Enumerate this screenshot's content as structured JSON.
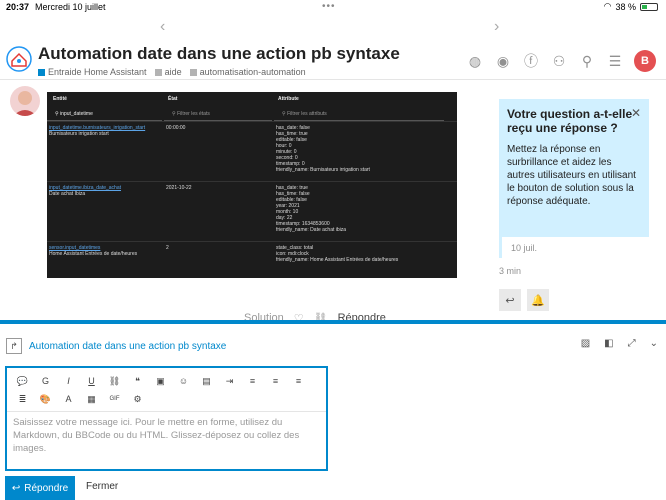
{
  "status_bar": {
    "time": "20:37",
    "date": "Mercredi 10 juillet",
    "battery": "38 %",
    "battery_level": 0.38
  },
  "topic": {
    "title": "Automation date dans une action pb syntaxe",
    "breadcrumbs": [
      {
        "label": "Entraide Home Assistant",
        "color": "#0088cc"
      },
      {
        "label": "aide",
        "color": "#b3b3b3"
      },
      {
        "label": "automatisation-automation",
        "color": "#b3b3b3"
      }
    ]
  },
  "header": {
    "user_initial": "B",
    "avatar_color": "#e45052"
  },
  "ha_screenshot": {
    "columns": [
      "Entité",
      "État",
      "Attribute"
    ],
    "filters": [
      "Filtrer les entités",
      "Filtrer les états",
      "Filtrer les attributs"
    ],
    "filter_value": "input_datetime",
    "rows": [
      {
        "entity": "input_datetime.burnisateurs_irrigation_start",
        "name": "Burnisateurs irrigation start",
        "state": "00:00:00",
        "attrs": [
          "has_date: false",
          "has_time: true",
          "editable: false",
          "hour: 0",
          "minute: 0",
          "second: 0",
          "timestamp: 0",
          "friendly_name: Burnisateurs irrigation start"
        ]
      },
      {
        "entity": "input_datetime.ibiza_date_achat",
        "name": "Date achat Ibiza",
        "state": "2021-10-22",
        "attrs": [
          "has_date: true",
          "has_time: false",
          "editable: false",
          "year: 2021",
          "month: 10",
          "day: 22",
          "timestamp: 1634853600",
          "friendly_name: Date achat ibiza"
        ]
      },
      {
        "entity": "sensor.input_datetimes",
        "name": "Home Assistant Entrées de date/heures",
        "state": "2",
        "attrs": [
          "state_class: total",
          "icon: mdi:clock",
          "friendly_name: Home Assistant Entrées de date/heures"
        ]
      }
    ]
  },
  "tooltip": {
    "title": "Votre question a-t-elle reçu une réponse ?",
    "body": "Mettez la réponse en surbrillance et aidez les autres utilisateurs en utilisant le bouton de solution sous la réponse adéquate."
  },
  "timeline": {
    "date": "10 juil.",
    "ago": "3 min"
  },
  "post_actions": {
    "solution": "Solution",
    "reply": "Répondre"
  },
  "composer": {
    "reply_title": "Automation date dans une action pb syntaxe",
    "placeholder": "Saisissez votre message ici. Pour le mettre en forme, utilisez du Markdown, du BBCode ou du HTML. Glissez-déposez ou collez des images.",
    "send_label": "Répondre",
    "cancel_label": "Fermer",
    "accent": "#0088cc"
  }
}
